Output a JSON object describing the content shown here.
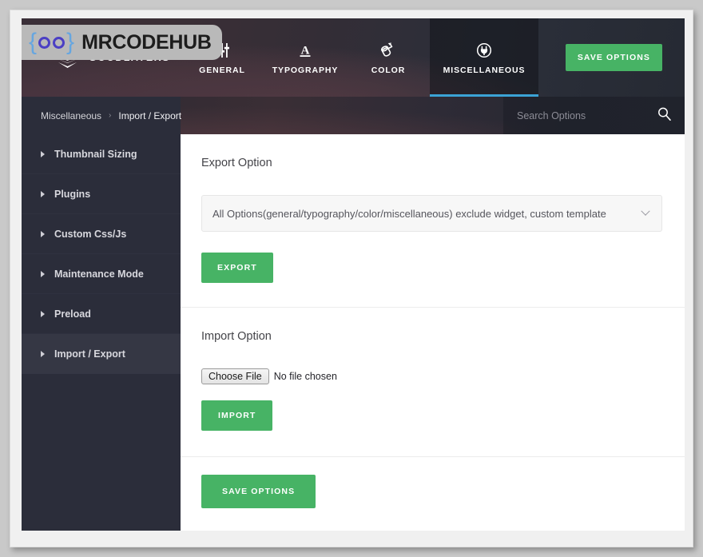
{
  "brand": {
    "name": "GOODLAYERS",
    "logo_icon": "stacked-cube-logo"
  },
  "watermark": {
    "text": "MRCODEHUB",
    "left_bracket": "{",
    "right_bracket": "}"
  },
  "header": {
    "tabs": [
      {
        "label": "GENERAL",
        "icon": "sliders-icon",
        "active": false
      },
      {
        "label": "TYPOGRAPHY",
        "icon": "letter-a-underline-icon",
        "active": false
      },
      {
        "label": "COLOR",
        "icon": "paint-bucket-icon",
        "active": false
      },
      {
        "label": "MISCELLANEOUS",
        "icon": "plug-circle-icon",
        "active": true
      }
    ],
    "save_label": "SAVE OPTIONS",
    "accent_active": "#3ba3d6",
    "green": "#47b365"
  },
  "breadcrumb": {
    "parent": "Miscellaneous",
    "separator": "›",
    "current": "Import / Export"
  },
  "search": {
    "placeholder": "Search Options",
    "value": "",
    "icon": "search-icon"
  },
  "sidebar": {
    "items": [
      {
        "label": "Thumbnail Sizing",
        "active": false
      },
      {
        "label": "Plugins",
        "active": false
      },
      {
        "label": "Custom Css/Js",
        "active": false
      },
      {
        "label": "Maintenance Mode",
        "active": false
      },
      {
        "label": "Preload",
        "active": false
      },
      {
        "label": "Import / Export",
        "active": true
      }
    ]
  },
  "main": {
    "export": {
      "title": "Export Option",
      "select_value": "All Options(general/typography/color/miscellaneous) exclude widget, custom template",
      "button_label": "EXPORT"
    },
    "import": {
      "title": "Import Option",
      "file_button_label": "Choose File",
      "file_status": "No file chosen",
      "button_label": "IMPORT"
    },
    "footer": {
      "save_label": "SAVE OPTIONS"
    }
  }
}
